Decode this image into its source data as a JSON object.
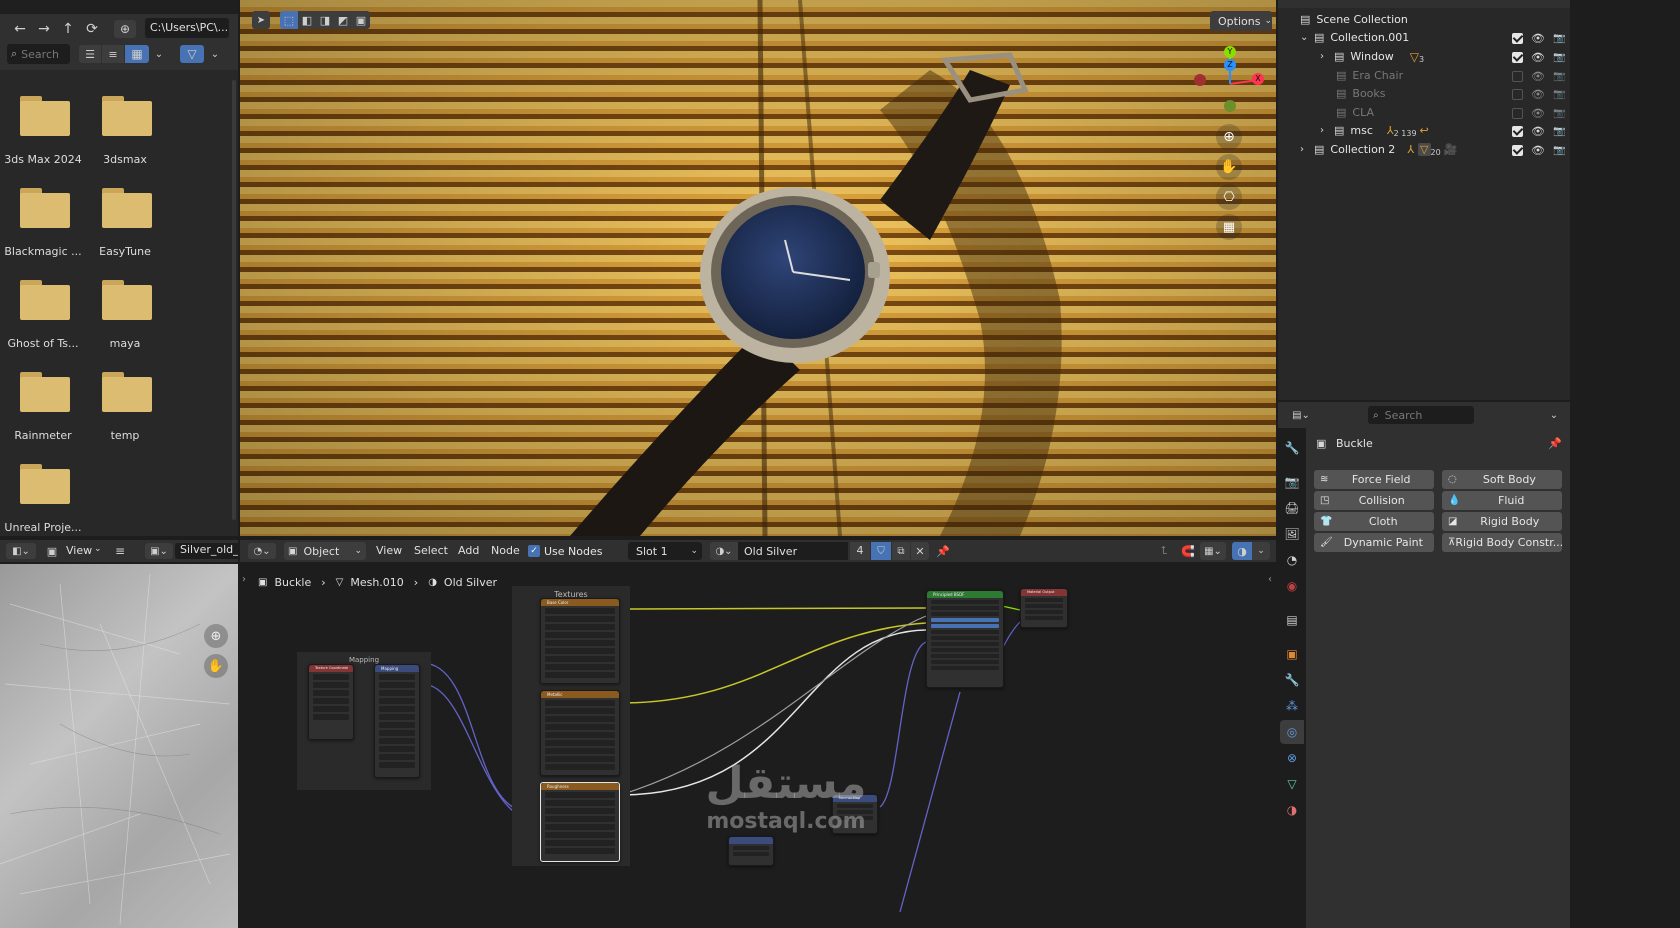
{
  "file_browser": {
    "path": "C:\\Users\\PC\\...",
    "search_placeholder": "Search",
    "folders": [
      "3ds Max 2024",
      "3dsmax",
      "Blackmagic ...",
      "EasyTune",
      "Ghost of Ts...",
      "maya",
      "Rainmeter",
      "temp",
      "Unreal Proje..."
    ]
  },
  "image_editor": {
    "view_label": "View",
    "image_name": "Silver_old_F"
  },
  "viewport": {
    "options_label": "Options",
    "gizmo_axes": {
      "y": "Y",
      "z": "Z",
      "x": "X"
    }
  },
  "outliner": {
    "rows": [
      {
        "label": "Scene Collection",
        "dim": false
      },
      {
        "label": "Collection.001",
        "dim": false
      },
      {
        "label": "Window",
        "dim": false,
        "badge": "3"
      },
      {
        "label": "Era Chair",
        "dim": true
      },
      {
        "label": "Books",
        "dim": true
      },
      {
        "label": "CLA",
        "dim": true
      },
      {
        "label": "msc",
        "dim": false,
        "badge": "2 139"
      },
      {
        "label": "Collection 2",
        "dim": false,
        "badge": "20"
      }
    ]
  },
  "properties": {
    "search_placeholder": "Search",
    "object_name": "Buckle",
    "physics_buttons": [
      [
        "Force Field",
        "Soft Body"
      ],
      [
        "Collision",
        "Fluid"
      ],
      [
        "Cloth",
        "Rigid Body"
      ],
      [
        "Dynamic Paint",
        "Rigid Body Constr..."
      ]
    ]
  },
  "shader_editor": {
    "mode": "Object",
    "menu": [
      "View",
      "Select",
      "Add",
      "Node"
    ],
    "use_nodes_label": "Use Nodes",
    "slot": "Slot 1",
    "material": "Old Silver",
    "user_count": "4",
    "breadcrumb": [
      "Buckle",
      "Mesh.010",
      "Old Silver"
    ],
    "frames": {
      "mapping": "Mapping",
      "textures": "Textures"
    },
    "nodes": {
      "texcoord": "Texture Coordinate",
      "mapping": "Mapping",
      "base_color": "Base Color",
      "metallic": "Metallic",
      "roughness": "Roughness",
      "bsdf": "Principled BSDF",
      "output": "Material Output",
      "normal_map": "Normal Map"
    }
  },
  "watermark": {
    "arabic": "مستقل",
    "latin": "mostaql.com"
  },
  "colors": {
    "accent_blue": "#4772b3",
    "link_yellow": "#c7c729",
    "link_grey": "#a1a1a1",
    "link_purple": "#6363c7",
    "header_bg": "#303030",
    "panel_bg": "#1d1d1d"
  }
}
